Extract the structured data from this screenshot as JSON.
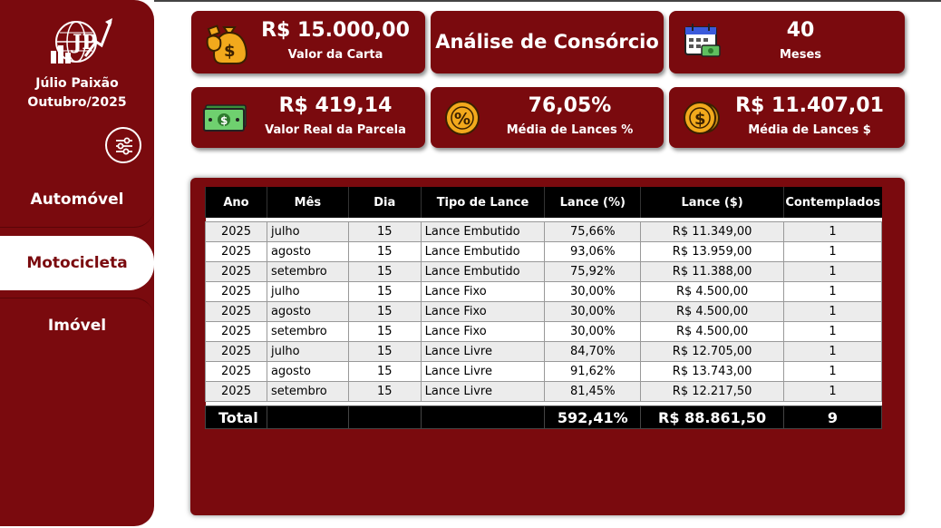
{
  "user": {
    "name": "Júlio Paixão",
    "date": "Outubro/2025"
  },
  "nav": {
    "items": [
      {
        "label": "Automóvel"
      },
      {
        "label": "Motocicleta"
      },
      {
        "label": "Imóvel"
      }
    ],
    "active": "Motocicleta"
  },
  "kpis": {
    "valor_carta": {
      "value": "R$ 15.000,00",
      "label": "Valor da Carta",
      "icon": "money-bag-icon"
    },
    "titulo": {
      "value": "Análise de Consórcio"
    },
    "meses": {
      "value": "40",
      "label": "Meses",
      "icon": "calendar-icon"
    },
    "parcela": {
      "value": "R$ 419,14",
      "label": "Valor Real da Parcela",
      "icon": "cash-bill-icon"
    },
    "media_pct": {
      "value": "76,05%",
      "label": "Média de Lances %",
      "icon": "percent-coin-icon"
    },
    "media_rs": {
      "value": "R$ 11.407,01",
      "label": "Média de Lances $",
      "icon": "dollar-coin-icon"
    }
  },
  "table": {
    "columns": [
      "Ano",
      "Mês",
      "Dia",
      "Tipo de Lance",
      "Lance (%)",
      "Lance ($)",
      "Contemplados"
    ],
    "rows": [
      [
        "2025",
        "julho",
        "15",
        "Lance Embutido",
        "75,66%",
        "R$ 11.349,00",
        "1"
      ],
      [
        "2025",
        "agosto",
        "15",
        "Lance Embutido",
        "93,06%",
        "R$ 13.959,00",
        "1"
      ],
      [
        "2025",
        "setembro",
        "15",
        "Lance Embutido",
        "75,92%",
        "R$ 11.388,00",
        "1"
      ],
      [
        "2025",
        "julho",
        "15",
        "Lance Fixo",
        "30,00%",
        "R$ 4.500,00",
        "1"
      ],
      [
        "2025",
        "agosto",
        "15",
        "Lance Fixo",
        "30,00%",
        "R$ 4.500,00",
        "1"
      ],
      [
        "2025",
        "setembro",
        "15",
        "Lance Fixo",
        "30,00%",
        "R$ 4.500,00",
        "1"
      ],
      [
        "2025",
        "julho",
        "15",
        "Lance Livre",
        "84,70%",
        "R$ 12.705,00",
        "1"
      ],
      [
        "2025",
        "agosto",
        "15",
        "Lance Livre",
        "91,62%",
        "R$ 13.743,00",
        "1"
      ],
      [
        "2025",
        "setembro",
        "15",
        "Lance Livre",
        "81,45%",
        "R$ 12.217,50",
        "1"
      ]
    ],
    "total": {
      "label": "Total",
      "pct": "592,41%",
      "valor": "R$ 88.861,50",
      "contemplados": "9"
    }
  },
  "colors": {
    "brand": "#7a0a0e",
    "header": "#000000",
    "accent_gold": "#f2a91c"
  }
}
